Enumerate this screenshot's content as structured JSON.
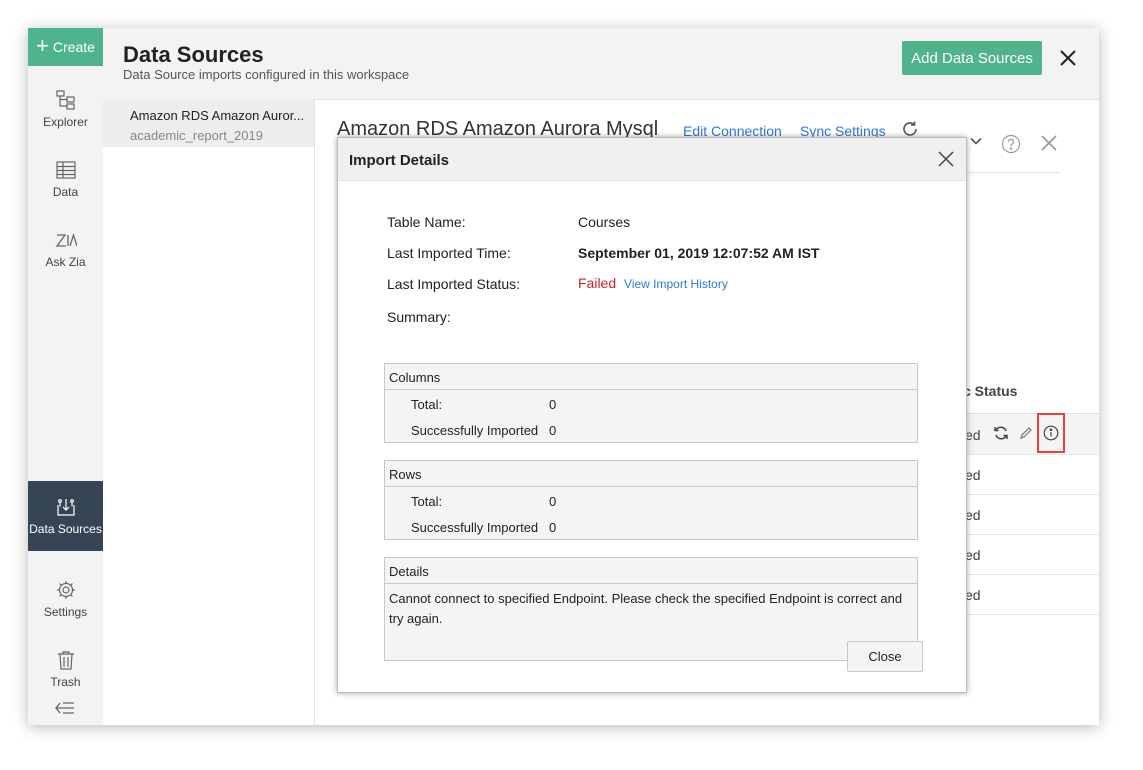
{
  "sidebar": {
    "create_label": "Create",
    "items": [
      {
        "label": "Explorer",
        "icon": "explorer-icon"
      },
      {
        "label": "Data",
        "icon": "table-icon"
      },
      {
        "label": "Ask Zia",
        "icon": "zia-icon"
      },
      {
        "label": "Data Sources",
        "icon": "data-sources-icon",
        "active": true
      },
      {
        "label": "Settings",
        "icon": "gear-icon"
      },
      {
        "label": "Trash",
        "icon": "trash-icon"
      }
    ],
    "collapse_icon": "collapse-left-icon"
  },
  "header": {
    "title": "Data Sources",
    "subtitle": "Data Source imports configured in this workspace",
    "add_button": "Add Data Sources"
  },
  "source_list": [
    {
      "name": "Amazon RDS Amazon Auror...",
      "workspace": "academic_report_2019"
    }
  ],
  "detail": {
    "title": "Amazon RDS Amazon Aurora Mysql",
    "edit_connection": "Edit Connection",
    "sync_settings": "Sync Settings",
    "column_header": "c Status",
    "row_status": [
      "ed",
      "ed",
      "ed",
      "ed",
      "ed"
    ]
  },
  "modal": {
    "title": "Import Details",
    "table_name_label": "Table Name:",
    "table_name_value": "Courses",
    "last_time_label": "Last Imported Time:",
    "last_time_value": "September 01, 2019 12:07:52 AM IST",
    "last_status_label": "Last Imported Status:",
    "last_status_value": "Failed",
    "view_history": "View Import History",
    "summary_label": "Summary:",
    "columns": {
      "header": "Columns",
      "total_label": "Total:",
      "total": "0",
      "imported_label": "Successfully Imported",
      "imported": "0"
    },
    "rows": {
      "header": "Rows",
      "total_label": "Total:",
      "total": "0",
      "imported_label": "Successfully Imported",
      "imported": "0"
    },
    "details": {
      "header": "Details",
      "text": "Cannot connect to specified Endpoint. Please check the specified Endpoint is correct and try again."
    },
    "close_button": "Close"
  },
  "colors": {
    "accent": "#4fb38c",
    "active_nav": "#364554",
    "link": "#2a7ad6",
    "error": "#cc2222",
    "highlight": "#e0443a"
  }
}
